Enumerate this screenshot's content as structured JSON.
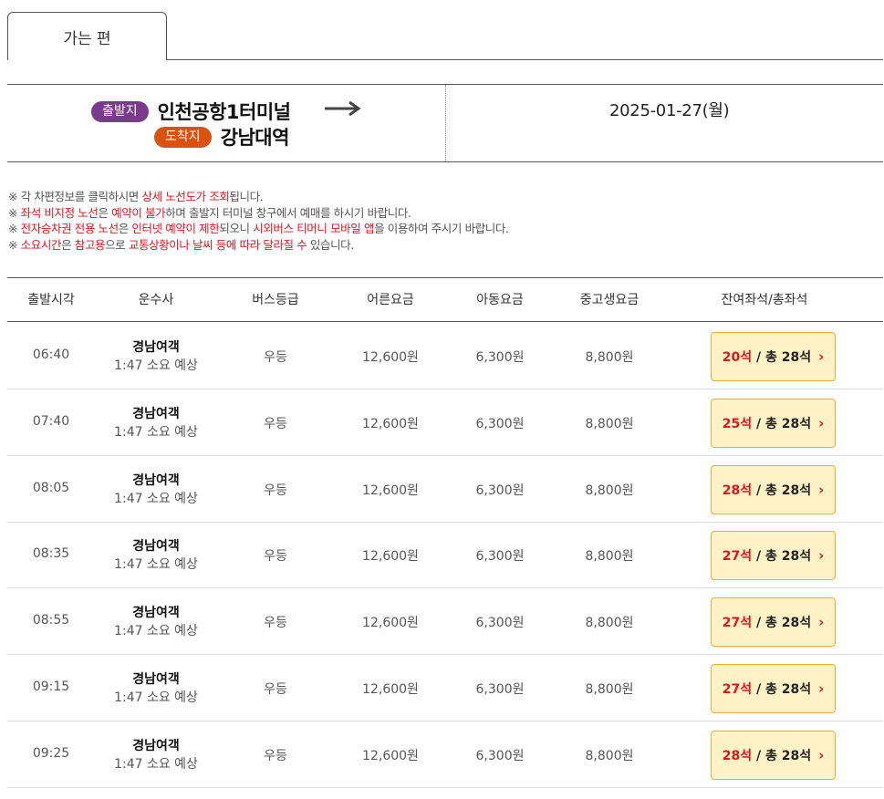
{
  "tab": {
    "label": "가는 편"
  },
  "route": {
    "departure_badge": "출발지",
    "departure": "인천공항1터미널",
    "arrival_badge": "도착지",
    "arrival": "강남대역",
    "date": "2025-01-27(월)"
  },
  "notices": [
    [
      {
        "t": "※ 각 차편정보를 클릭하시면 "
      },
      {
        "t": "상세 노선도가 조회",
        "hl": true
      },
      {
        "t": "됩니다."
      }
    ],
    [
      {
        "t": "※ "
      },
      {
        "t": "좌석 비지정 노선",
        "hl": true
      },
      {
        "t": "은 "
      },
      {
        "t": "예약이 불가",
        "hl": true
      },
      {
        "t": "하며 출발지 터미널 창구에서 예매를 하시기 바랍니다."
      }
    ],
    [
      {
        "t": "※ "
      },
      {
        "t": "전자승차권 전용 노선",
        "hl": true
      },
      {
        "t": "은 "
      },
      {
        "t": "인터넷 예약이 제한",
        "hl": true
      },
      {
        "t": "되오니 "
      },
      {
        "t": "시외버스 티머니 모바일 앱",
        "hl": true
      },
      {
        "t": "을 이용하여 주시기 바랍니다."
      }
    ],
    [
      {
        "t": "※ "
      },
      {
        "t": "소요시간",
        "hl": true
      },
      {
        "t": "은 "
      },
      {
        "t": "참고용",
        "hl": true
      },
      {
        "t": "으로 "
      },
      {
        "t": "교통상황이나 날씨 등에 따라 달라질 수",
        "hl": true
      },
      {
        "t": " 있습니다."
      }
    ]
  ],
  "table": {
    "headers": [
      "출발시각",
      "운수사",
      "버스등급",
      "어른요금",
      "아동요금",
      "중고생요금",
      "잔여좌석/총좌석"
    ],
    "rows": [
      {
        "time": "06:40",
        "company": "경남여객",
        "duration": "1:47 소요 예상",
        "grade": "우등",
        "adult": "12,600원",
        "child": "6,300원",
        "youth": "8,800원",
        "remaining": "20석",
        "total": " / 총 28석"
      },
      {
        "time": "07:40",
        "company": "경남여객",
        "duration": "1:47 소요 예상",
        "grade": "우등",
        "adult": "12,600원",
        "child": "6,300원",
        "youth": "8,800원",
        "remaining": "25석",
        "total": " / 총 28석"
      },
      {
        "time": "08:05",
        "company": "경남여객",
        "duration": "1:47 소요 예상",
        "grade": "우등",
        "adult": "12,600원",
        "child": "6,300원",
        "youth": "8,800원",
        "remaining": "28석",
        "total": " / 총 28석"
      },
      {
        "time": "08:35",
        "company": "경남여객",
        "duration": "1:47 소요 예상",
        "grade": "우등",
        "adult": "12,600원",
        "child": "6,300원",
        "youth": "8,800원",
        "remaining": "27석",
        "total": " / 총 28석"
      },
      {
        "time": "08:55",
        "company": "경남여객",
        "duration": "1:47 소요 예상",
        "grade": "우등",
        "adult": "12,600원",
        "child": "6,300원",
        "youth": "8,800원",
        "remaining": "27석",
        "total": " / 총 28석"
      },
      {
        "time": "09:15",
        "company": "경남여객",
        "duration": "1:47 소요 예상",
        "grade": "우등",
        "adult": "12,600원",
        "child": "6,300원",
        "youth": "8,800원",
        "remaining": "27석",
        "total": " / 총 28석"
      },
      {
        "time": "09:25",
        "company": "경남여객",
        "duration": "1:47 소요 예상",
        "grade": "우등",
        "adult": "12,600원",
        "child": "6,300원",
        "youth": "8,800원",
        "remaining": "28석",
        "total": " / 총 28석"
      }
    ]
  },
  "colors": {
    "departure_badge": "#7b3b8c",
    "arrival_badge": "#d9530f",
    "highlight": "#e0141e",
    "seat_button_bg": "#fff2c6",
    "seat_button_border": "#f0ab3a"
  },
  "icons": {
    "route_arrow": "right-arrow-icon",
    "seat_chevron": "chevron-right-icon"
  }
}
